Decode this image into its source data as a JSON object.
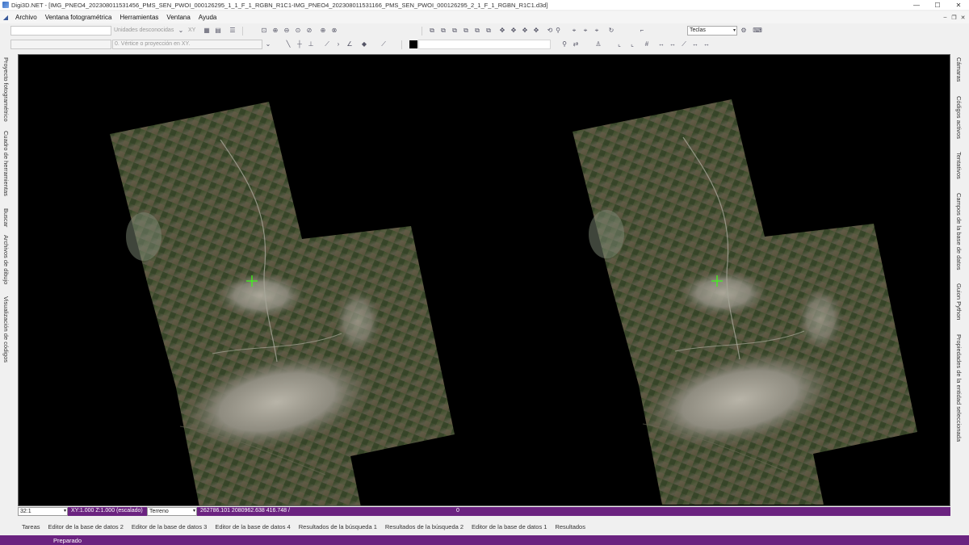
{
  "window": {
    "title": "Digi3D.NET - [IMG_PNEO4_202308011531456_PMS_SEN_PWOI_000126295_1_1_F_1_RGBN_R1C1-IMG_PNEO4_202308011531166_PMS_SEN_PWOI_000126295_2_1_F_1_RGBN_R1C1.d3d]",
    "minimize": "—",
    "maximize": "☐",
    "close": "✕"
  },
  "menu": {
    "items": [
      "Archivo",
      "Ventana fotogramétrica",
      "Herramientas",
      "Ventana",
      "Ayuda"
    ],
    "mdi_minimize": "–",
    "mdi_restore": "❐",
    "mdi_close": "✕"
  },
  "toolbar1": {
    "coord_input": "",
    "xy_label": "XY",
    "units_label": "Unidades desconocidas",
    "keys_dropdown": "Teclas"
  },
  "toolbar2": {
    "command_input": "",
    "vertex_prompt": "0. Vértice o proyección en XY."
  },
  "left_panel": {
    "tabs": [
      "Proyecto fotogramétrico",
      "Cuadro de herramientas",
      "Buscar",
      "Archivos de dibujo",
      "Visualización de códigos"
    ]
  },
  "right_panel": {
    "tabs": [
      "Cámaras",
      "Códigos activos",
      "Tentativos",
      "Campos de la base de datos",
      "Guion Python",
      "Propiedades de la entidad seleccionada"
    ]
  },
  "status": {
    "zoom": "32:1",
    "scale_text": "XY:1.000 Z:1.000 (escalado)",
    "terrain": "Terreno",
    "coordinates": "262786.101 2080962.638 416.748 /",
    "counter": "0"
  },
  "doc_tabs": [
    "Tareas",
    "Editor de la base de datos 2",
    "Editor de la base de datos 3",
    "Editor de la base de datos 4",
    "Resultados de la búsqueda 1",
    "Resultados de la búsqueda 2",
    "Editor de la base de datos 1",
    "Resultados"
  ],
  "bottom_status": "Preparado",
  "colors": {
    "accent": "#6b2380",
    "viewport_bg": "#000000",
    "cursor": "#39ff14"
  }
}
